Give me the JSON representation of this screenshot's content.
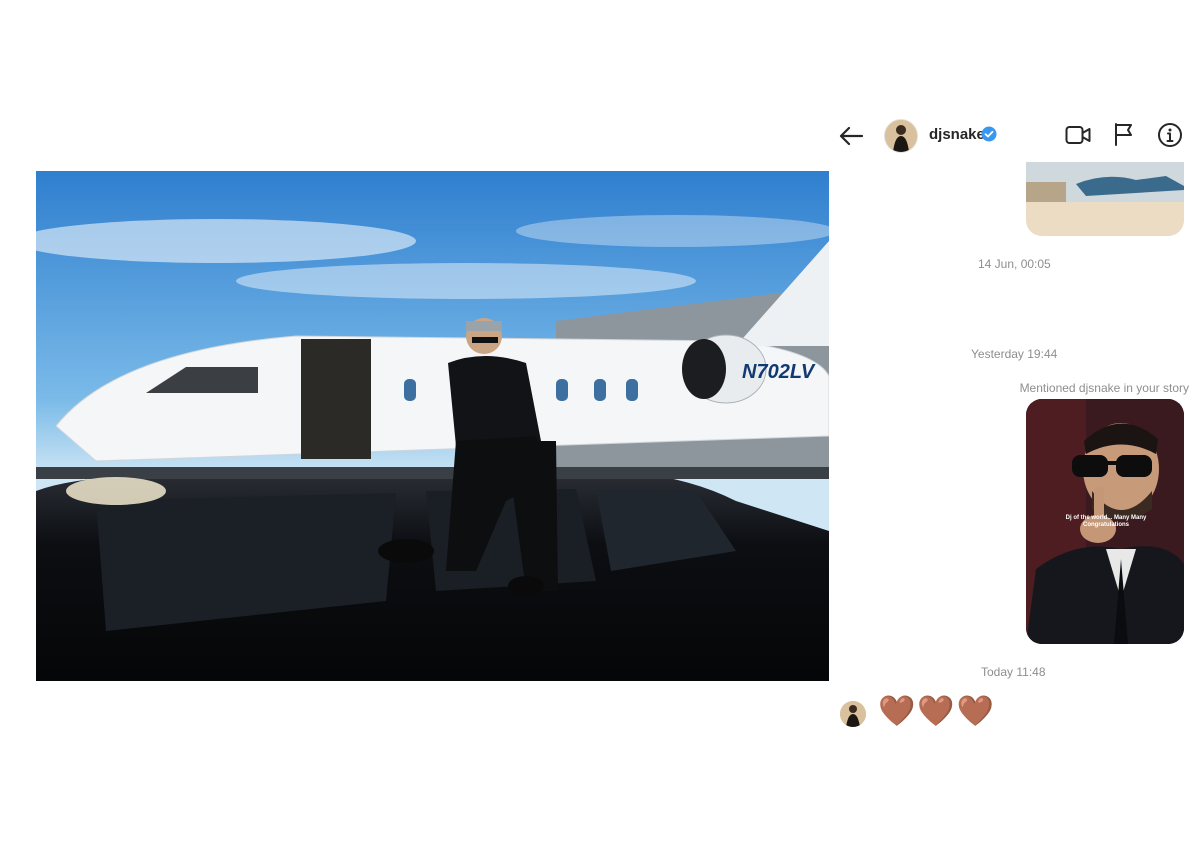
{
  "photo": {
    "alt_subject": "man seated on black SUV in front of private jet",
    "tail_number": "N702LV"
  },
  "header": {
    "username": "djsnake"
  },
  "messages": {
    "timestamp_1": "14 Jun, 00:05",
    "timestamp_2": "Yesterday 19:44",
    "mention_label": "Mentioned djsnake in your story",
    "story_caption": "Dj of the world... Many Many Congratulations",
    "timestamp_3": "Today 11:48",
    "reaction": "🤎🤎🤎"
  },
  "colors": {
    "verified": "#3897f0",
    "heart": "#b07a5a",
    "text_secondary": "#8e8e8e"
  }
}
